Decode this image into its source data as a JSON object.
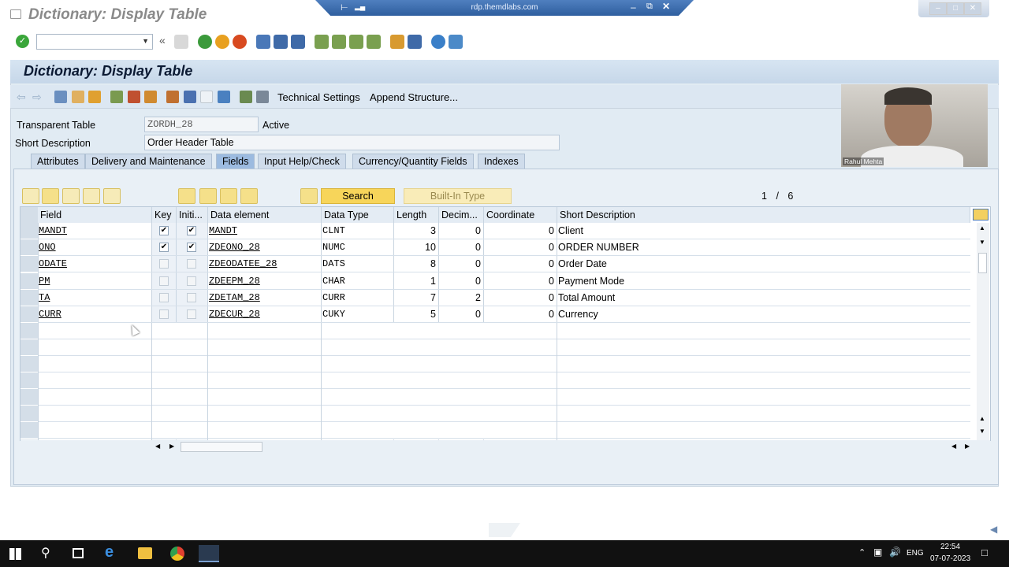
{
  "window": {
    "title": "Dictionary: Display Table"
  },
  "rdp": {
    "host": "rdp.themdlabs.com"
  },
  "screen": {
    "title": "Dictionary: Display Table"
  },
  "app_toolbar": {
    "technical_settings": "Technical Settings",
    "append_structure": "Append Structure..."
  },
  "form": {
    "transparent_table_label": "Transparent Table",
    "transparent_table_value": "ZORDH_28",
    "status": "Active",
    "short_description_label": "Short Description",
    "short_description_value": "Order Header Table"
  },
  "tabs": [
    {
      "label": "Attributes"
    },
    {
      "label": "Delivery and Maintenance"
    },
    {
      "label": "Fields"
    },
    {
      "label": "Input Help/Check"
    },
    {
      "label": "Currency/Quantity Fields"
    },
    {
      "label": "Indexes"
    }
  ],
  "table_toolbar": {
    "search": "Search",
    "builtin_type": "Built-In Type",
    "pager_current": "1",
    "pager_sep": "/",
    "pager_total": "6"
  },
  "columns": [
    "Field",
    "Key",
    "Initi...",
    "Data element",
    "Data Type",
    "Length",
    "Decim...",
    "Coordinate",
    "Short Description"
  ],
  "rows": [
    {
      "field": "MANDT",
      "key": true,
      "init": true,
      "element": "MANDT",
      "type": "CLNT",
      "length": "3",
      "dec": "0",
      "coord": "0",
      "desc": "Client"
    },
    {
      "field": "ONO",
      "key": true,
      "init": true,
      "element": "ZDEONO_28",
      "type": "NUMC",
      "length": "10",
      "dec": "0",
      "coord": "0",
      "desc": "ORDER NUMBER"
    },
    {
      "field": "ODATE",
      "key": false,
      "init": false,
      "element": "ZDEODATEE_28",
      "type": "DATS",
      "length": "8",
      "dec": "0",
      "coord": "0",
      "desc": "Order Date"
    },
    {
      "field": "PM",
      "key": false,
      "init": false,
      "element": "ZDEEPM_28",
      "type": "CHAR",
      "length": "1",
      "dec": "0",
      "coord": "0",
      "desc": "Payment Mode"
    },
    {
      "field": "TA",
      "key": false,
      "init": false,
      "element": "ZDETAM_28",
      "type": "CURR",
      "length": "7",
      "dec": "2",
      "coord": "0",
      "desc": "Total Amount"
    },
    {
      "field": "CURR",
      "key": false,
      "init": false,
      "element": "ZDECUR_28",
      "type": "CUKY",
      "length": "5",
      "dec": "0",
      "coord": "0",
      "desc": "Currency"
    }
  ],
  "video": {
    "name": "Rahul Mehta"
  },
  "taskbar": {
    "lang": "ENG",
    "time": "22:54",
    "date": "07-07-2023"
  },
  "colors": {
    "accent": "#f7d55a",
    "header_bg": "#c6d7e9",
    "frame_bg": "#e1ebf3"
  }
}
